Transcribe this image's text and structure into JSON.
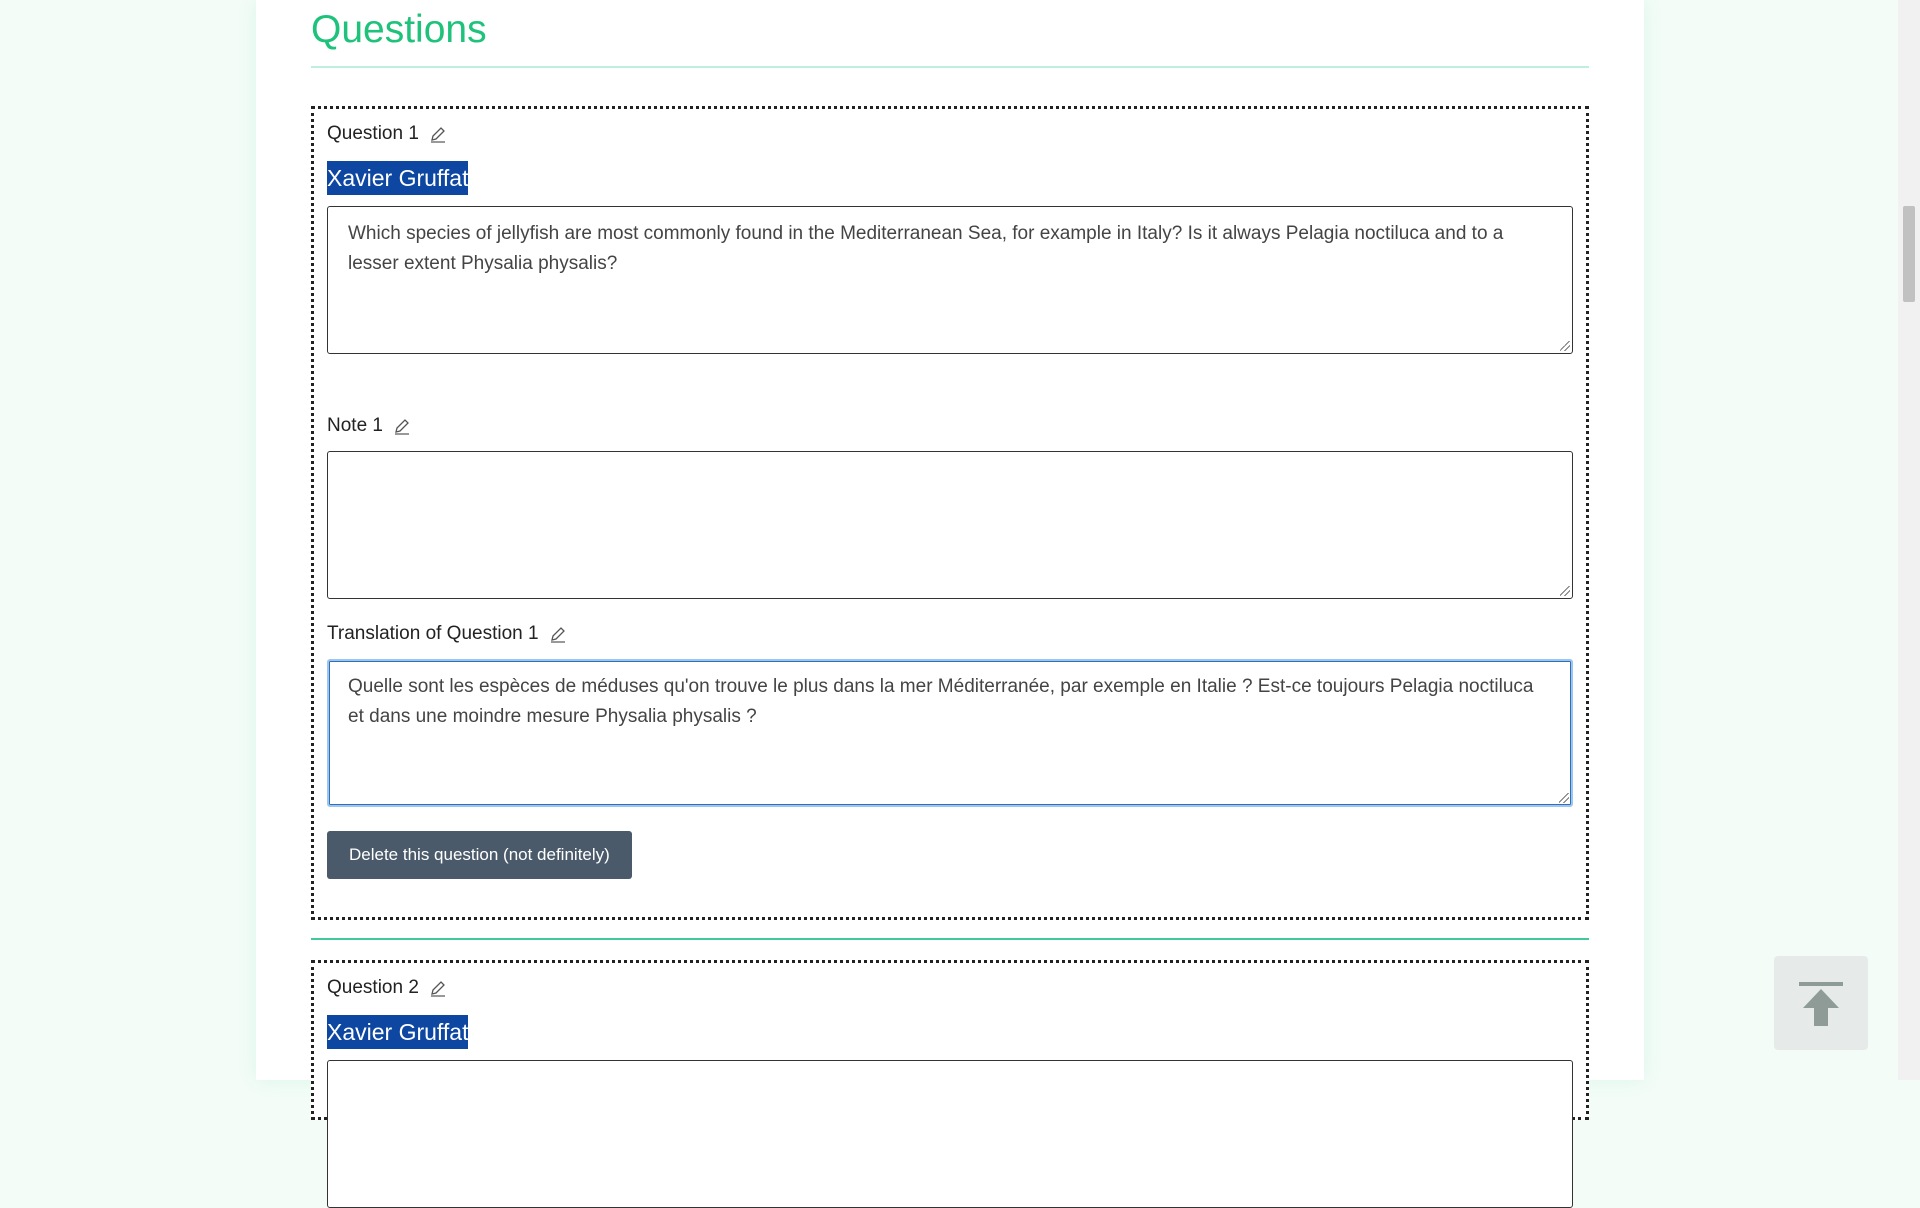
{
  "section": {
    "title": "Questions"
  },
  "questions": [
    {
      "label": "Question 1",
      "author": "Xavier Gruffat",
      "question_text": "Which species of jellyfish are most commonly found in the Mediterranean Sea, for example in Italy? Is it always Pelagia noctiluca and to a lesser extent Physalia physalis?",
      "note_label": "Note 1",
      "note_text": "",
      "translation_label": "Translation of Question 1",
      "translation_text": "Quelle sont les espèces de méduses qu'on trouve le plus dans la mer Méditerranée, par exemple en Italie ? Est-ce toujours Pelagia noctiluca et dans une moindre mesure Physalia physalis ?",
      "delete_label": "Delete this question (not definitely)"
    },
    {
      "label": "Question 2",
      "author": "Xavier Gruffat"
    }
  ],
  "icons": {
    "edit": "pencil-icon",
    "back_to_top": "arrow-up-icon"
  },
  "colors": {
    "accent": "#1ec27a",
    "author_bg": "#0d47a1",
    "button_bg": "#4a5a6a"
  }
}
